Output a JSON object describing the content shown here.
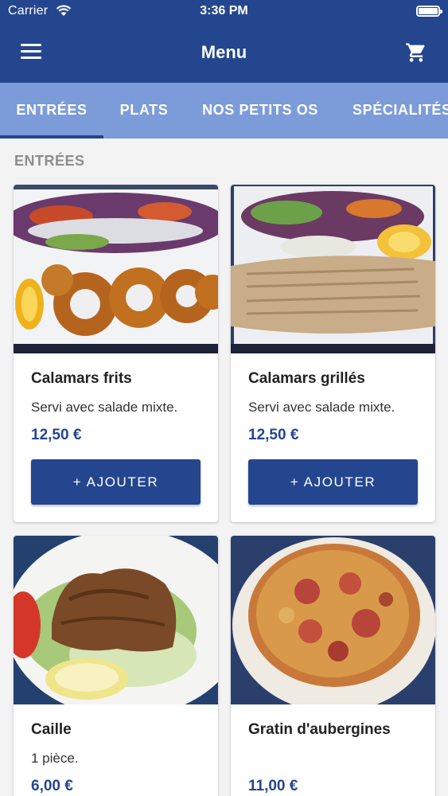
{
  "status_bar": {
    "carrier": "Carrier",
    "time": "3:36 PM"
  },
  "header": {
    "title": "Menu",
    "menu_icon": "hamburger-icon",
    "cart_icon": "cart-icon"
  },
  "tabs": [
    {
      "label": "ENTRÉES",
      "active": true
    },
    {
      "label": "PLATS",
      "active": false
    },
    {
      "label": "NOS PETITS OS",
      "active": false
    },
    {
      "label": "SPÉCIALITÉS",
      "active": false
    }
  ],
  "section": {
    "title": "ENTRÉES"
  },
  "items": [
    {
      "name": "Calamars frits",
      "description": "Servi avec salade mixte.",
      "price": "12,50 €",
      "button": "+ AJOUTER"
    },
    {
      "name": "Calamars grillés",
      "description": "Servi avec salade mixte.",
      "price": "12,50 €",
      "button": "+ AJOUTER"
    },
    {
      "name": "Caille",
      "description": "1 pièce.",
      "price": "6,00 €"
    },
    {
      "name": "Gratin d'aubergines",
      "description": "",
      "price": "11,00 €"
    }
  ],
  "colors": {
    "primary": "#24468f",
    "tab_bar": "#7c9bd9",
    "background": "#f3f3f4",
    "section_title": "#8d8d8d"
  }
}
